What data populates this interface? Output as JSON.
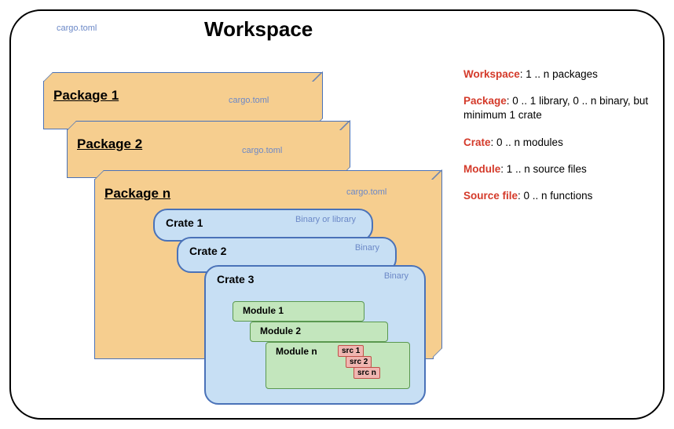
{
  "workspace": {
    "title": "Workspace",
    "cargo_label": "cargo.toml"
  },
  "packages": [
    {
      "title": "Package 1",
      "cargo_label": "cargo.toml"
    },
    {
      "title": "Package 2",
      "cargo_label": "cargo.toml"
    },
    {
      "title": "Package n",
      "cargo_label": "cargo.toml"
    }
  ],
  "crates": [
    {
      "title": "Crate 1",
      "type_label": "Binary or library"
    },
    {
      "title": "Crate 2",
      "type_label": "Binary"
    },
    {
      "title": "Crate 3",
      "type_label": "Binary"
    }
  ],
  "modules": [
    {
      "title": "Module 1"
    },
    {
      "title": "Module 2"
    },
    {
      "title": "Module n"
    }
  ],
  "srcs": [
    {
      "label": "src 1"
    },
    {
      "label": "src 2"
    },
    {
      "label": "src n"
    }
  ],
  "legend": {
    "workspace": {
      "term": "Workspace",
      "desc": ": 1 .. n packages"
    },
    "package": {
      "term": "Package",
      "desc": ": 0 .. 1 library, 0 .. n binary, but minimum 1 crate"
    },
    "crate": {
      "term": "Crate",
      "desc": ": 0 .. n modules"
    },
    "module": {
      "term": "Module",
      "desc": ": 1 .. n source files"
    },
    "source": {
      "term": "Source file",
      "desc": ": 0 .. n functions"
    }
  },
  "chart_data": {
    "type": "hierarchy-diagram",
    "title": "Workspace",
    "hierarchy": [
      {
        "level": "Workspace",
        "contains": "Package",
        "cardinality": "1 .. n packages"
      },
      {
        "level": "Package",
        "contains": "Crate",
        "cardinality": "0 .. 1 library, 0 .. n binary, minimum 1 crate"
      },
      {
        "level": "Crate",
        "contains": "Module",
        "cardinality": "0 .. n modules"
      },
      {
        "level": "Module",
        "contains": "Source file",
        "cardinality": "1 .. n source files"
      },
      {
        "level": "Source file",
        "contains": "function",
        "cardinality": "0 .. n functions"
      }
    ],
    "config_file": "cargo.toml"
  }
}
